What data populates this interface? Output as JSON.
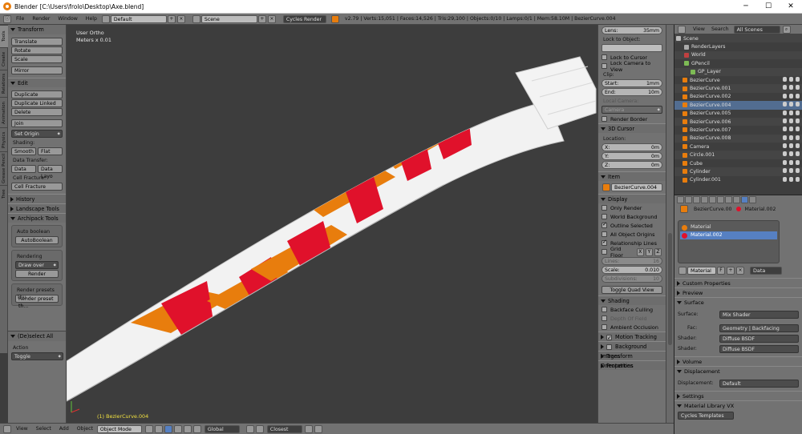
{
  "window": {
    "title": "Blender [C:\\Users\\frolo\\Desktop\\Axe.blend]"
  },
  "menu": [
    "File",
    "Render",
    "Window",
    "Help"
  ],
  "header": {
    "screen": "Default",
    "scene": "Scene",
    "engine": "Cycles Render",
    "stats": "v2.79 | Verts:15,051 | Faces:14,526 | Tris:29,100 | Objects:0/10 | Lamps:0/1 | Mem:58.10M | BezierCurve.004"
  },
  "tabs": [
    "Tools",
    "Create",
    "Relations",
    "Animation",
    "Physics",
    "Grease Pencil",
    "Tree"
  ],
  "tools": {
    "transform": {
      "title": "Transform",
      "items": [
        "Translate",
        "Rotate",
        "Scale",
        "Mirror"
      ]
    },
    "edit": {
      "title": "Edit",
      "items": [
        "Duplicate",
        "Duplicate Linked",
        "Delete",
        "Join",
        "Set Origin"
      ],
      "shading_label": "Shading:",
      "smooth": "Smooth",
      "flat": "Flat",
      "data_transfer_label": "Data Transfer:",
      "data": "Data",
      "data_layo": "Data Layo",
      "cell_fracture_label": "Cell Fracture:",
      "cell_fracture": "Cell Fracture"
    },
    "history": "History",
    "landscape": "Landscape Tools",
    "archipack": "Archipack Tools",
    "auto_boolean": "Auto boolean",
    "auto_boolean_btn": "AutoBoolean",
    "rendering": "Rendering",
    "draw_over": "Draw over",
    "render": "Render",
    "render_presets": "Render presets Thu...",
    "render_preset_btn": "Render preset th...",
    "deselect": "(De)select All",
    "action_label": "Action",
    "action_value": "Toggle"
  },
  "viewport": {
    "view": "User Ortho",
    "units": "Meters x 0.01",
    "object": "(1) BezierCurve.004"
  },
  "props": {
    "lens": "Lens:",
    "lens_val": "35mm",
    "lock_object": "Lock to Object:",
    "lock_cursor": "Lock to Cursor",
    "lock_camera": "Lock Camera to View",
    "clip": "Clip:",
    "start": "Start:",
    "start_val": "1mm",
    "end": "End:",
    "end_val": "10m",
    "local_camera": "Local Camera:",
    "camera": "Camera",
    "render_border": "Render Border",
    "cursor_title": "3D Cursor",
    "location": "Location:",
    "x": "X:",
    "y": "Y:",
    "z": "Z:",
    "zero": "0m",
    "item_title": "Item",
    "item_name": "BezierCurve.004",
    "display_title": "Display",
    "only_render": "Only Render",
    "world_bg": "World Background",
    "outline_sel": "Outline Selected",
    "all_origins": "All Object Origins",
    "rel_lines": "Relationship Lines",
    "grid_floor": "Grid Floor",
    "gx": "X",
    "gy": "Y",
    "gz": "Z",
    "lines": "Lines:",
    "lines_val": "16",
    "scale": "Scale:",
    "scale_val": "0.010",
    "subdiv": "Subdivisions:",
    "subdiv_val": "10",
    "quad": "Toggle Quad View",
    "shading_title": "Shading",
    "backface": "Backface Culling",
    "dof": "Depth Of Field",
    "ao": "Ambient Occlusion",
    "motion": "Motion Tracking",
    "bg_images": "Background Images",
    "orient": "Transform Orientations",
    "properties": "Properties"
  },
  "outliner": {
    "view": "View",
    "search": "Search",
    "filter": "All Scenes",
    "items": [
      "Scene",
      "RenderLayers",
      "World",
      "GPencil",
      "GP_Layer",
      "BezierCurve",
      "BezierCurve.001",
      "BezierCurve.002",
      "BezierCurve.004",
      "BezierCurve.005",
      "BezierCurve.006",
      "BezierCurve.007",
      "BezierCurve.008",
      "Camera",
      "Circle.001",
      "Cube",
      "Cylinder",
      "Cylinder.001"
    ]
  },
  "material": {
    "breadcrumb_obj": "BezierCurve.00",
    "breadcrumb_mat": "Material.002",
    "slots": [
      "Material",
      "Material.002"
    ],
    "slot_colors": [
      "#e87d0d",
      "#e0112b"
    ],
    "name": "Material",
    "f": "F",
    "data": "Data",
    "sections": {
      "custom": "Custom Properties",
      "preview": "Preview",
      "surface": "Surface",
      "volume": "Volume",
      "displacement": "Displacement",
      "settings": "Settings",
      "library": "Material Library VX"
    },
    "surface_label": "Surface:",
    "surface_val": "Mix Shader",
    "fac_label": "Fac:",
    "fac_val": "Geometry | Backfacing",
    "shader_label": "Shader:",
    "shader1": "Diffuse BSDF",
    "shader2": "Diffuse BSDF",
    "disp_label": "Displacement:",
    "disp_val": "Default",
    "lib": "Cycles Templates"
  },
  "bottom": [
    "View",
    "Select",
    "Add",
    "Object"
  ],
  "bottom_mode": "Object Mode",
  "bottom_orient": "Global",
  "bottom_snap": "Closest"
}
